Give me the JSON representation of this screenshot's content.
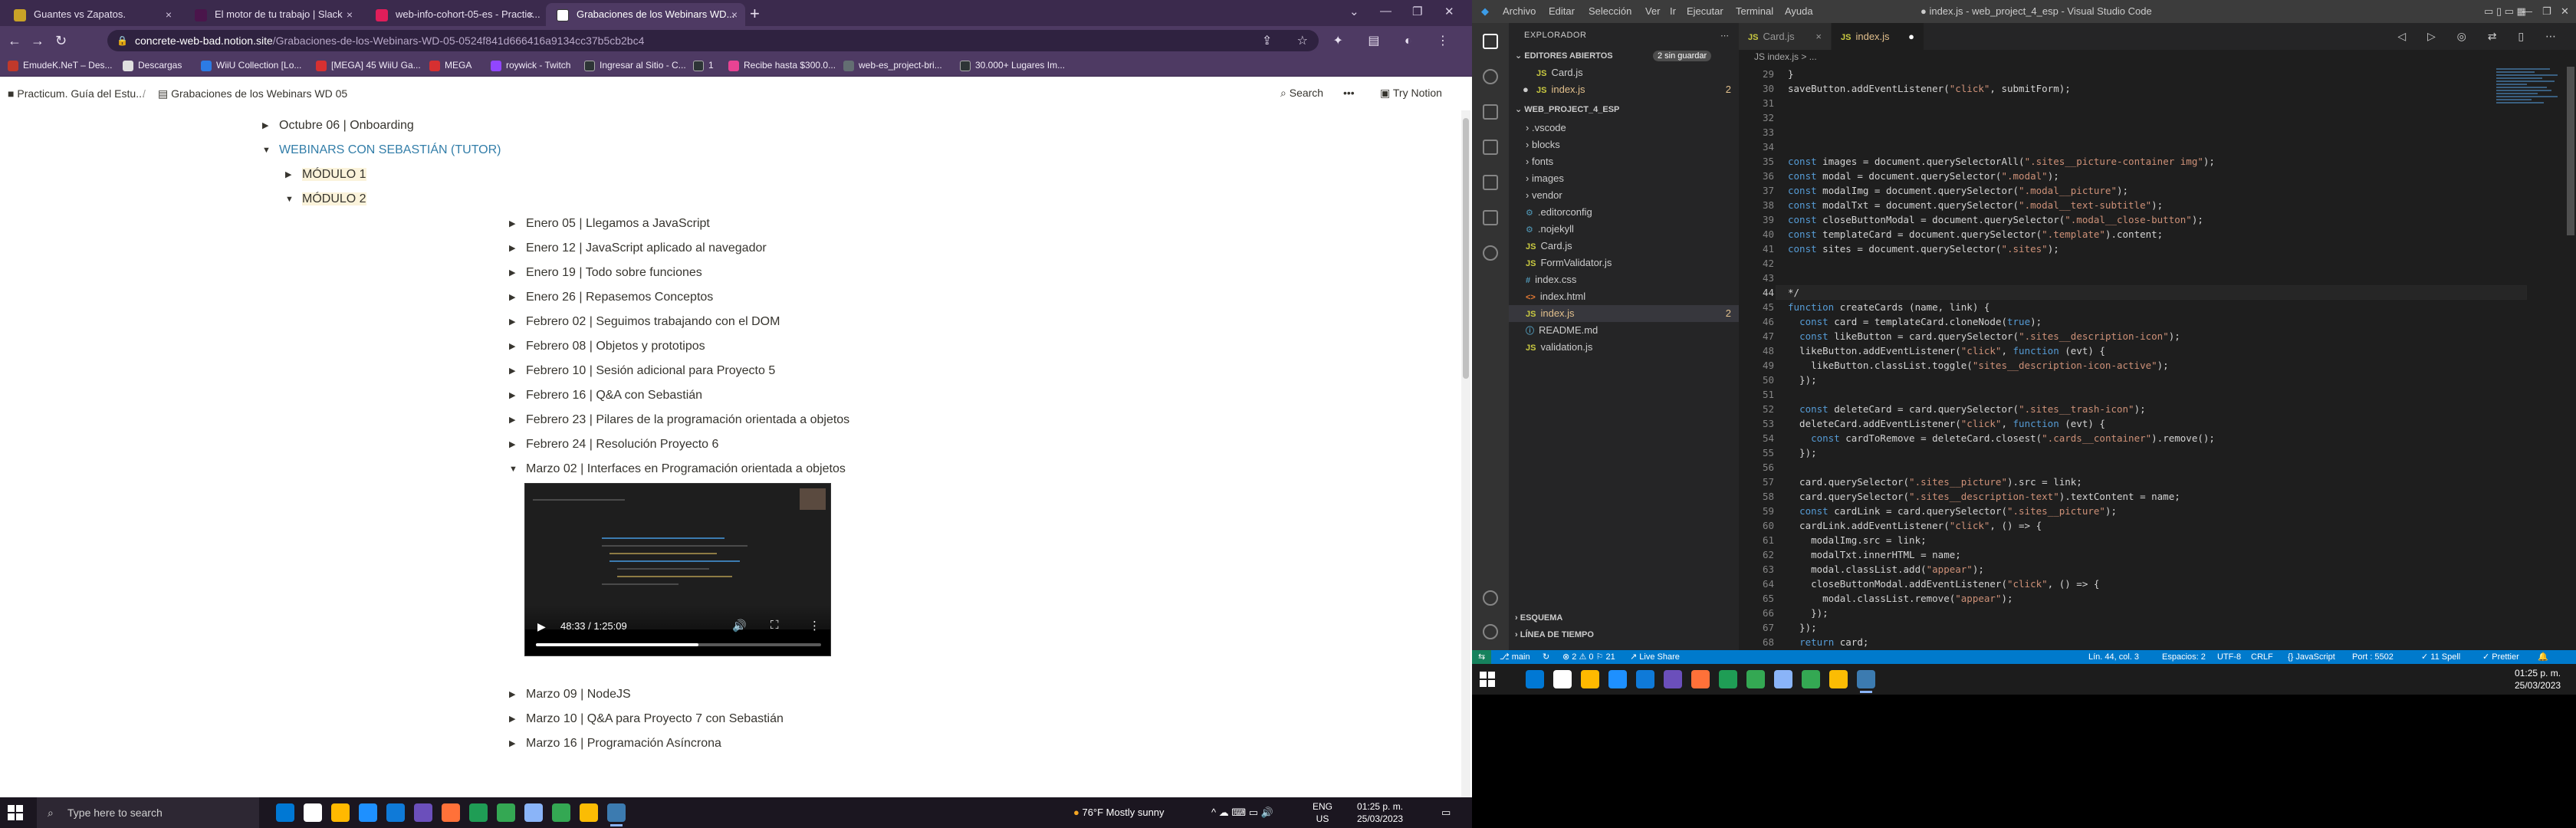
{
  "chrome": {
    "tabs": [
      {
        "title": "Guantes vs Zapatos.",
        "color": "#c9a227",
        "close": "×"
      },
      {
        "title": "El motor de tu trabajo | Slack",
        "color": "#4a154b",
        "close": "×"
      },
      {
        "title": "web-info-cohort-05-es - Practic...",
        "color": "#e01e5a",
        "close": "×"
      },
      {
        "title": "Grabaciones de los Webinars WD...",
        "color": "#ffffff",
        "close": "×"
      }
    ],
    "new_tab": "+",
    "window_controls": [
      "⌄",
      "—",
      "❐",
      "✕"
    ],
    "nav": {
      "back": "←",
      "forward": "→",
      "reload": "↻"
    },
    "url": {
      "host": "concrete-web-bad.notion.site",
      "path": "/Grabaciones-de-los-Webinars-WD-05-0524f841d666416a9134cc37b5cb2bc4"
    },
    "toolbar_icons": "⇪ ☆ ✦ ▤ ◐ ⋮",
    "bookmarks": [
      {
        "label": "EmudeK.NeT – Des...",
        "color": "#c0392b"
      },
      {
        "label": "Descargas",
        "color": "#e0e0e0"
      },
      {
        "label": "WiiU Collection [Lo...",
        "color": "#2c7be5"
      },
      {
        "label": "[MEGA] 45 WiiU Ga...",
        "color": "#d63031"
      },
      {
        "label": "MEGA",
        "color": "#d63031"
      },
      {
        "label": "roywick - Twitch",
        "color": "#9146ff"
      },
      {
        "label": "Ingresar al Sitio - C...",
        "color": "#2d3436"
      },
      {
        "label": "1",
        "color": "#2d3436"
      },
      {
        "label": "Recibe hasta $300.0...",
        "color": "#e84393"
      },
      {
        "label": "web-es_project-bri...",
        "color": "#636e72"
      },
      {
        "label": "30.000+ Lugares Im...",
        "color": "#2d3436"
      }
    ]
  },
  "notion": {
    "breadcrumb": [
      "Practicum. Guía del Estu...",
      "Grabaciones de los Webinars WD 05"
    ],
    "breadcrumb_sep": "/",
    "search": "Search",
    "more": "•••",
    "try": "Try Notion",
    "toggles": [
      {
        "label": "Octubre 06 | Onboarding",
        "open": false,
        "blue": false
      },
      {
        "label": "WEBINARS CON SEBASTIÁN (TUTOR)",
        "open": true,
        "blue": true
      },
      {
        "label": "MÓDULO 1",
        "open": false,
        "blue": false
      },
      {
        "label": "MÓDULO 2",
        "open": true,
        "blue": false
      },
      {
        "label": "Enero 05 | Llegamos a JavaScript",
        "open": false,
        "blue": false
      },
      {
        "label": "Enero 12 | JavaScript aplicado al navegador",
        "open": false,
        "blue": false
      },
      {
        "label": "Enero 19 | Todo sobre funciones",
        "open": false,
        "blue": false
      },
      {
        "label": "Enero 26 | Repasemos Conceptos",
        "open": false,
        "blue": false
      },
      {
        "label": "Febrero 02 | Seguimos trabajando con el DOM",
        "open": false,
        "blue": false
      },
      {
        "label": "Febrero 08 | Objetos y prototipos",
        "open": false,
        "blue": false
      },
      {
        "label": "Febrero 10 | Sesión adicional para Proyecto 5",
        "open": false,
        "blue": false
      },
      {
        "label": "Febrero 16 | Q&A con Sebastián",
        "open": false,
        "blue": false
      },
      {
        "label": "Febrero 23 | Pilares de la programación orientada a objetos",
        "open": false,
        "blue": false
      },
      {
        "label": "Febrero 24 | Resolución Proyecto 6",
        "open": false,
        "blue": false
      },
      {
        "label": "Marzo 02 | Interfaces en Programación orientada a objetos",
        "open": true,
        "blue": false
      },
      {
        "label": "Marzo 09 | NodeJS",
        "open": false,
        "blue": false
      },
      {
        "label": "Marzo 10 | Q&A para Proyecto 7 con Sebastián",
        "open": false,
        "blue": false
      },
      {
        "label": "Marzo 16 | Programación Asíncrona",
        "open": false,
        "blue": false
      }
    ],
    "video": {
      "time": "48:33 / 1:25:09",
      "progress": 0.57,
      "play": "▶",
      "vol": "🔊",
      "fs": "⛶",
      "more": "⋮"
    }
  },
  "taskbar_left": {
    "search_placeholder": "Type here to search",
    "apps": [
      "#0078d4",
      "#ffffff",
      "#ffb900",
      "#1e90ff",
      "#0f7ad8",
      "#6b4fbb",
      "#ff7139",
      "#1f9d55",
      "#34a853",
      "#8ab4f8",
      "#34a853",
      "#fbbc04",
      "#3c7bb0"
    ],
    "weather": "76°F  Mostly sunny",
    "tray": "^ ☁ ⌨ ▭ 🔊",
    "lang": "ENG\nUS",
    "clock_time": "01:25 p. m.",
    "clock_date": "25/03/2023"
  },
  "vscode": {
    "menu": [
      "Archivo",
      "Editar",
      "Selección",
      "Ver",
      "Ir",
      "Ejecutar",
      "Terminal",
      "Ayuda"
    ],
    "title": "● index.js - web_project_4_esp - Visual Studio Code",
    "explorer": "EXPLORADOR",
    "open_editors": "EDITORES ABIERTOS",
    "unsaved": "2 sin guardar",
    "open_files": [
      {
        "name": "Card.js",
        "kind": "js",
        "badge": ""
      },
      {
        "name": "index.js",
        "kind": "js",
        "badge": "2"
      }
    ],
    "project": "WEB_PROJECT_4_ESP",
    "tree": [
      {
        "name": ".vscode",
        "kind": "folder",
        "badge": ""
      },
      {
        "name": "blocks",
        "kind": "folder",
        "badge": ""
      },
      {
        "name": "fonts",
        "kind": "folder",
        "badge": ""
      },
      {
        "name": "images",
        "kind": "folder",
        "badge": ""
      },
      {
        "name": "vendor",
        "kind": "folder",
        "badge": ""
      },
      {
        "name": ".editorconfig",
        "kind": "cfg",
        "badge": ""
      },
      {
        "name": ".nojekyll",
        "kind": "cfg",
        "badge": ""
      },
      {
        "name": "Card.js",
        "kind": "js",
        "badge": ""
      },
      {
        "name": "FormValidator.js",
        "kind": "js",
        "badge": ""
      },
      {
        "name": "index.css",
        "kind": "css",
        "badge": ""
      },
      {
        "name": "index.html",
        "kind": "html",
        "badge": ""
      },
      {
        "name": "index.js",
        "kind": "js",
        "badge": "2"
      },
      {
        "name": "README.md",
        "kind": "md",
        "badge": ""
      },
      {
        "name": "validation.js",
        "kind": "js",
        "badge": ""
      }
    ],
    "outline": "ESQUEMA",
    "timeline": "LÍNEA DE TIEMPO",
    "tabs": [
      {
        "name": "Card.js",
        "active": false,
        "mark": "×"
      },
      {
        "name": "index.js",
        "active": true,
        "mark": "●"
      }
    ],
    "editor_crumb": "JS index.js > ...",
    "current_line": 44,
    "code": [
      {
        "n": 29,
        "t": "}"
      },
      {
        "n": 30,
        "t": "saveButton.addEventListener(\"click\", submitForm);"
      },
      {
        "n": 31,
        "t": ""
      },
      {
        "n": 32,
        "t": ""
      },
      {
        "n": 33,
        "t": ""
      },
      {
        "n": 34,
        "t": ""
      },
      {
        "n": 35,
        "t": "const images = document.querySelectorAll(\".sites__picture-container img\");"
      },
      {
        "n": 36,
        "t": "const modal = document.querySelector(\".modal\");"
      },
      {
        "n": 37,
        "t": "const modalImg = document.querySelector(\".modal__picture\");"
      },
      {
        "n": 38,
        "t": "const modalTxt = document.querySelector(\".modal__text-subtitle\");"
      },
      {
        "n": 39,
        "t": "const closeButtonModal = document.querySelector(\".modal__close-button\");"
      },
      {
        "n": 40,
        "t": "const templateCard = document.querySelector(\".template\").content;"
      },
      {
        "n": 41,
        "t": "const sites = document.querySelector(\".sites\");"
      },
      {
        "n": 42,
        "t": ""
      },
      {
        "n": 43,
        "t": ""
      },
      {
        "n": 44,
        "t": "*/"
      },
      {
        "n": 45,
        "t": "function createCards (name, link) {"
      },
      {
        "n": 46,
        "t": "  const card = templateCard.cloneNode(true);"
      },
      {
        "n": 47,
        "t": "  const likeButton = card.querySelector(\".sites__description-icon\");"
      },
      {
        "n": 48,
        "t": "  likeButton.addEventListener(\"click\", function (evt) {"
      },
      {
        "n": 49,
        "t": "    likeButton.classList.toggle(\"sites__description-icon-active\");"
      },
      {
        "n": 50,
        "t": "  });"
      },
      {
        "n": 51,
        "t": ""
      },
      {
        "n": 52,
        "t": "  const deleteCard = card.querySelector(\".sites__trash-icon\");"
      },
      {
        "n": 53,
        "t": "  deleteCard.addEventListener(\"click\", function (evt) {"
      },
      {
        "n": 54,
        "t": "    const cardToRemove = deleteCard.closest(\".cards__container\").remove();"
      },
      {
        "n": 55,
        "t": "  });"
      },
      {
        "n": 56,
        "t": ""
      },
      {
        "n": 57,
        "t": "  card.querySelector(\".sites__picture\").src = link;"
      },
      {
        "n": 58,
        "t": "  card.querySelector(\".sites__description-text\").textContent = name;"
      },
      {
        "n": 59,
        "t": "  const cardLink = card.querySelector(\".sites__picture\");"
      },
      {
        "n": 60,
        "t": "  cardLink.addEventListener(\"click\", () => {"
      },
      {
        "n": 61,
        "t": "    modalImg.src = link;"
      },
      {
        "n": 62,
        "t": "    modalTxt.innerHTML = name;"
      },
      {
        "n": 63,
        "t": "    modal.classList.add(\"appear\");"
      },
      {
        "n": 64,
        "t": "    closeButtonModal.addEventListener(\"click\", () => {"
      },
      {
        "n": 65,
        "t": "      modal.classList.remove(\"appear\");"
      },
      {
        "n": 66,
        "t": "    });"
      },
      {
        "n": 67,
        "t": "  });"
      },
      {
        "n": 68,
        "t": "  return card;"
      }
    ],
    "status": {
      "branch": "⎇ main",
      "sync": "↻",
      "problems": "⊗ 2 ⚠ 0 ⚐ 21",
      "liveshare": "Live Share",
      "pos": "Lín. 44, col. 3",
      "spaces": "Espacios: 2",
      "enc": "UTF-8",
      "eol": "CRLF",
      "lang": "{} JavaScript",
      "port": "Port : 5502",
      "spell": "✓ 11 Spell",
      "prettier": "✓ Prettier"
    }
  },
  "taskbar_right": {
    "apps": [
      "#0078d4",
      "#ffffff",
      "#ffb900",
      "#1e90ff",
      "#0f7ad8",
      "#6b4fbb",
      "#ff7139",
      "#1f9d55",
      "#34a853",
      "#8ab4f8",
      "#34a853",
      "#fbbc04",
      "#3c7bb0"
    ],
    "clock_time": "01:25 p. m.",
    "clock_date": "25/03/2023"
  }
}
